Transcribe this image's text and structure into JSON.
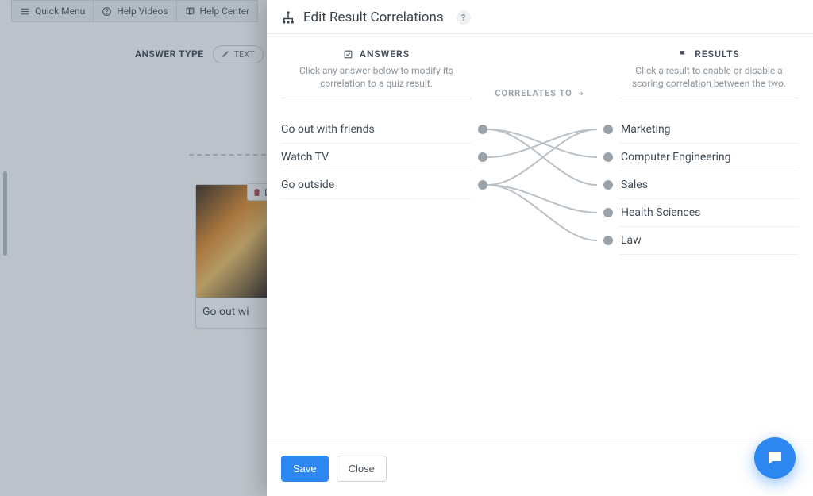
{
  "topbar": {
    "quick_menu": "Quick Menu",
    "help_videos": "Help Videos",
    "help_center": "Help Center"
  },
  "editor": {
    "answer_type_label": "ANSWER TYPE",
    "text_pill": "TEXT",
    "card_caption": "Go out wi"
  },
  "modal": {
    "title": "Edit Result Correlations",
    "help_badge": "?",
    "answers_heading": "ANSWERS",
    "answers_desc": "Click any answer below to modify its correlation to a quiz result.",
    "results_heading": "RESULTS",
    "results_desc": "Click a result to enable or disable a scoring correlation between the two.",
    "correlates_label": "CORRELATES TO",
    "answers": [
      "Go out with friends",
      "Watch TV",
      "Go outside"
    ],
    "results": [
      "Marketing",
      "Computer Engineering",
      "Sales",
      "Health Sciences",
      "Law"
    ],
    "save": "Save",
    "close": "Close"
  }
}
